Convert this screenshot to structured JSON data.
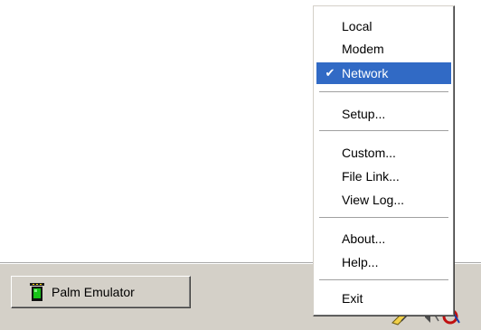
{
  "taskbar": {
    "button_label": "Palm Emulator",
    "button_icon": "palm-emulator-icon"
  },
  "tray": {
    "icons": [
      "network-connection-icon",
      "speaker-icon",
      "palm-emulator-tray-icon"
    ]
  },
  "menu": {
    "items": [
      {
        "label": "Local",
        "checked": false
      },
      {
        "label": "Modem",
        "checked": false
      },
      {
        "label": "Network",
        "checked": true
      },
      {
        "label": "Setup...",
        "checked": false
      },
      {
        "label": "Custom...",
        "checked": false
      },
      {
        "label": "File Link...",
        "checked": false
      },
      {
        "label": "View Log...",
        "checked": false
      },
      {
        "label": "About...",
        "checked": false
      },
      {
        "label": "Help...",
        "checked": false
      },
      {
        "label": "Exit",
        "checked": false
      }
    ],
    "check_glyph": "✔"
  },
  "colors": {
    "menu_highlight": "#316ac5",
    "taskbar_face": "#d4d0c8",
    "menu_background": "#ffffff"
  }
}
